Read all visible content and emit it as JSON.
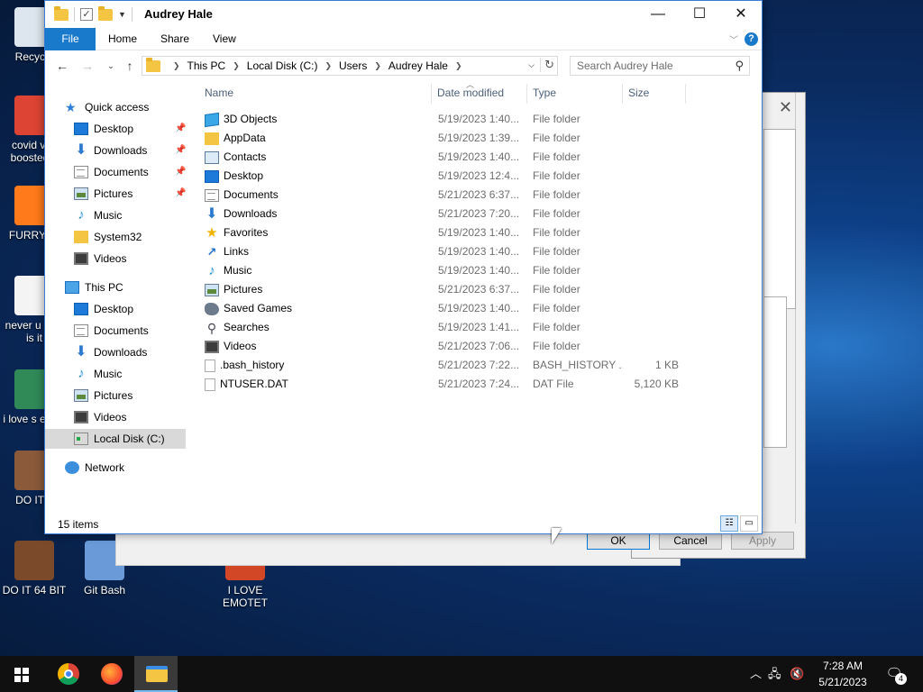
{
  "desktop": {
    "icons": [
      {
        "label": "Recycle",
        "color": "#dde6ef"
      },
      {
        "label": "covid vac boosted h",
        "color": "#dd4433"
      },
      {
        "label": "FURRY CI",
        "color": "#ff7a1a"
      },
      {
        "label": "never u why is it",
        "color": "#f4f4f4"
      },
      {
        "label": "i love s editin",
        "color": "#2f8a58"
      },
      {
        "label": "DO IT L",
        "color": "#8a5a3a"
      },
      {
        "label": "DO IT 64 BIT",
        "color": "#7a4a2a"
      },
      {
        "label": "Git Bash",
        "color": "#6a9ad8"
      },
      {
        "label": "I LOVE EMOTET",
        "color": "#d24726"
      }
    ]
  },
  "window": {
    "title": "Audrey Hale",
    "controls": {
      "minimize": "—",
      "maximize": "☐",
      "close": "✕"
    },
    "ribbon": {
      "file": "File",
      "home": "Home",
      "share": "Share",
      "view": "View",
      "help": "?"
    },
    "nav": {
      "back": "←",
      "forward": "→",
      "recent": "⌄",
      "up": "↑"
    },
    "breadcrumb": [
      "This PC",
      "Local Disk (C:)",
      "Users",
      "Audrey Hale"
    ],
    "search_placeholder": "Search Audrey Hale"
  },
  "navpane": {
    "quick_access": "Quick access",
    "qa_items": [
      {
        "label": "Desktop",
        "icon": "desktop-icon",
        "pinned": true
      },
      {
        "label": "Downloads",
        "icon": "downloads-icon",
        "pinned": true
      },
      {
        "label": "Documents",
        "icon": "documents-icon",
        "pinned": true
      },
      {
        "label": "Pictures",
        "icon": "pictures-icon",
        "pinned": true
      },
      {
        "label": "Music",
        "icon": "music-icon",
        "pinned": false
      },
      {
        "label": "System32",
        "icon": "folder-icon",
        "pinned": false
      },
      {
        "label": "Videos",
        "icon": "videos-icon",
        "pinned": false
      }
    ],
    "this_pc": "This PC",
    "pc_items": [
      {
        "label": "Desktop"
      },
      {
        "label": "Documents"
      },
      {
        "label": "Downloads"
      },
      {
        "label": "Music"
      },
      {
        "label": "Pictures"
      },
      {
        "label": "Videos"
      },
      {
        "label": "Local Disk (C:)"
      }
    ],
    "network": "Network"
  },
  "columns": {
    "name": "Name",
    "date": "Date modified",
    "type": "Type",
    "size": "Size"
  },
  "files": [
    {
      "name": "3D Objects",
      "date": "5/19/2023 1:40...",
      "type": "File folder",
      "size": "",
      "icon": "3d-objects-icon"
    },
    {
      "name": "AppData",
      "date": "5/19/2023 1:39...",
      "type": "File folder",
      "size": "",
      "icon": "folder-icon"
    },
    {
      "name": "Contacts",
      "date": "5/19/2023 1:40...",
      "type": "File folder",
      "size": "",
      "icon": "contacts-icon"
    },
    {
      "name": "Desktop",
      "date": "5/19/2023 12:4...",
      "type": "File folder",
      "size": "",
      "icon": "desktop-icon"
    },
    {
      "name": "Documents",
      "date": "5/21/2023 6:37...",
      "type": "File folder",
      "size": "",
      "icon": "documents-icon"
    },
    {
      "name": "Downloads",
      "date": "5/21/2023 7:20...",
      "type": "File folder",
      "size": "",
      "icon": "downloads-icon"
    },
    {
      "name": "Favorites",
      "date": "5/19/2023 1:40...",
      "type": "File folder",
      "size": "",
      "icon": "favorites-icon"
    },
    {
      "name": "Links",
      "date": "5/19/2023 1:40...",
      "type": "File folder",
      "size": "",
      "icon": "links-icon"
    },
    {
      "name": "Music",
      "date": "5/19/2023 1:40...",
      "type": "File folder",
      "size": "",
      "icon": "music-icon"
    },
    {
      "name": "Pictures",
      "date": "5/21/2023 6:37...",
      "type": "File folder",
      "size": "",
      "icon": "pictures-icon"
    },
    {
      "name": "Saved Games",
      "date": "5/19/2023 1:40...",
      "type": "File folder",
      "size": "",
      "icon": "saved-games-icon"
    },
    {
      "name": "Searches",
      "date": "5/19/2023 1:41...",
      "type": "File folder",
      "size": "",
      "icon": "searches-icon"
    },
    {
      "name": "Videos",
      "date": "5/21/2023 7:06...",
      "type": "File folder",
      "size": "",
      "icon": "videos-icon"
    },
    {
      "name": ".bash_history",
      "date": "5/21/2023 7:22...",
      "type": "BASH_HISTORY ...",
      "size": "1 KB",
      "icon": "file-icon"
    },
    {
      "name": "NTUSER.DAT",
      "date": "5/21/2023 7:24...",
      "type": "DAT File",
      "size": "5,120 KB",
      "icon": "file-icon"
    }
  ],
  "status": {
    "count": "15 items"
  },
  "dialog": {
    "ok": "OK",
    "cancel": "Cancel",
    "apply": "Apply",
    "close": "✕"
  },
  "taskbar": {
    "time": "7:28 AM",
    "date": "5/21/2023",
    "notifications": "4"
  }
}
